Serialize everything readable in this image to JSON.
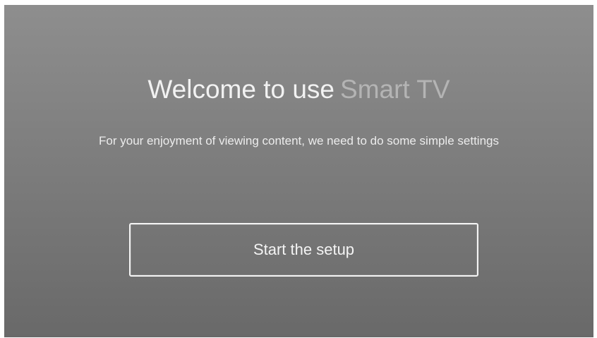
{
  "welcome": {
    "title_prefix": "Welcome to use",
    "brand": "Smart TV",
    "subtitle": "For your enjoyment of viewing content, we need to do some simple settings"
  },
  "actions": {
    "start_label": "Start the setup"
  },
  "colors": {
    "background_top": "#8e8e8e",
    "background_bottom": "#696969",
    "text": "#f2f2f2",
    "brand_text": "#b4b4b4",
    "button_border": "#f4f4f4"
  }
}
